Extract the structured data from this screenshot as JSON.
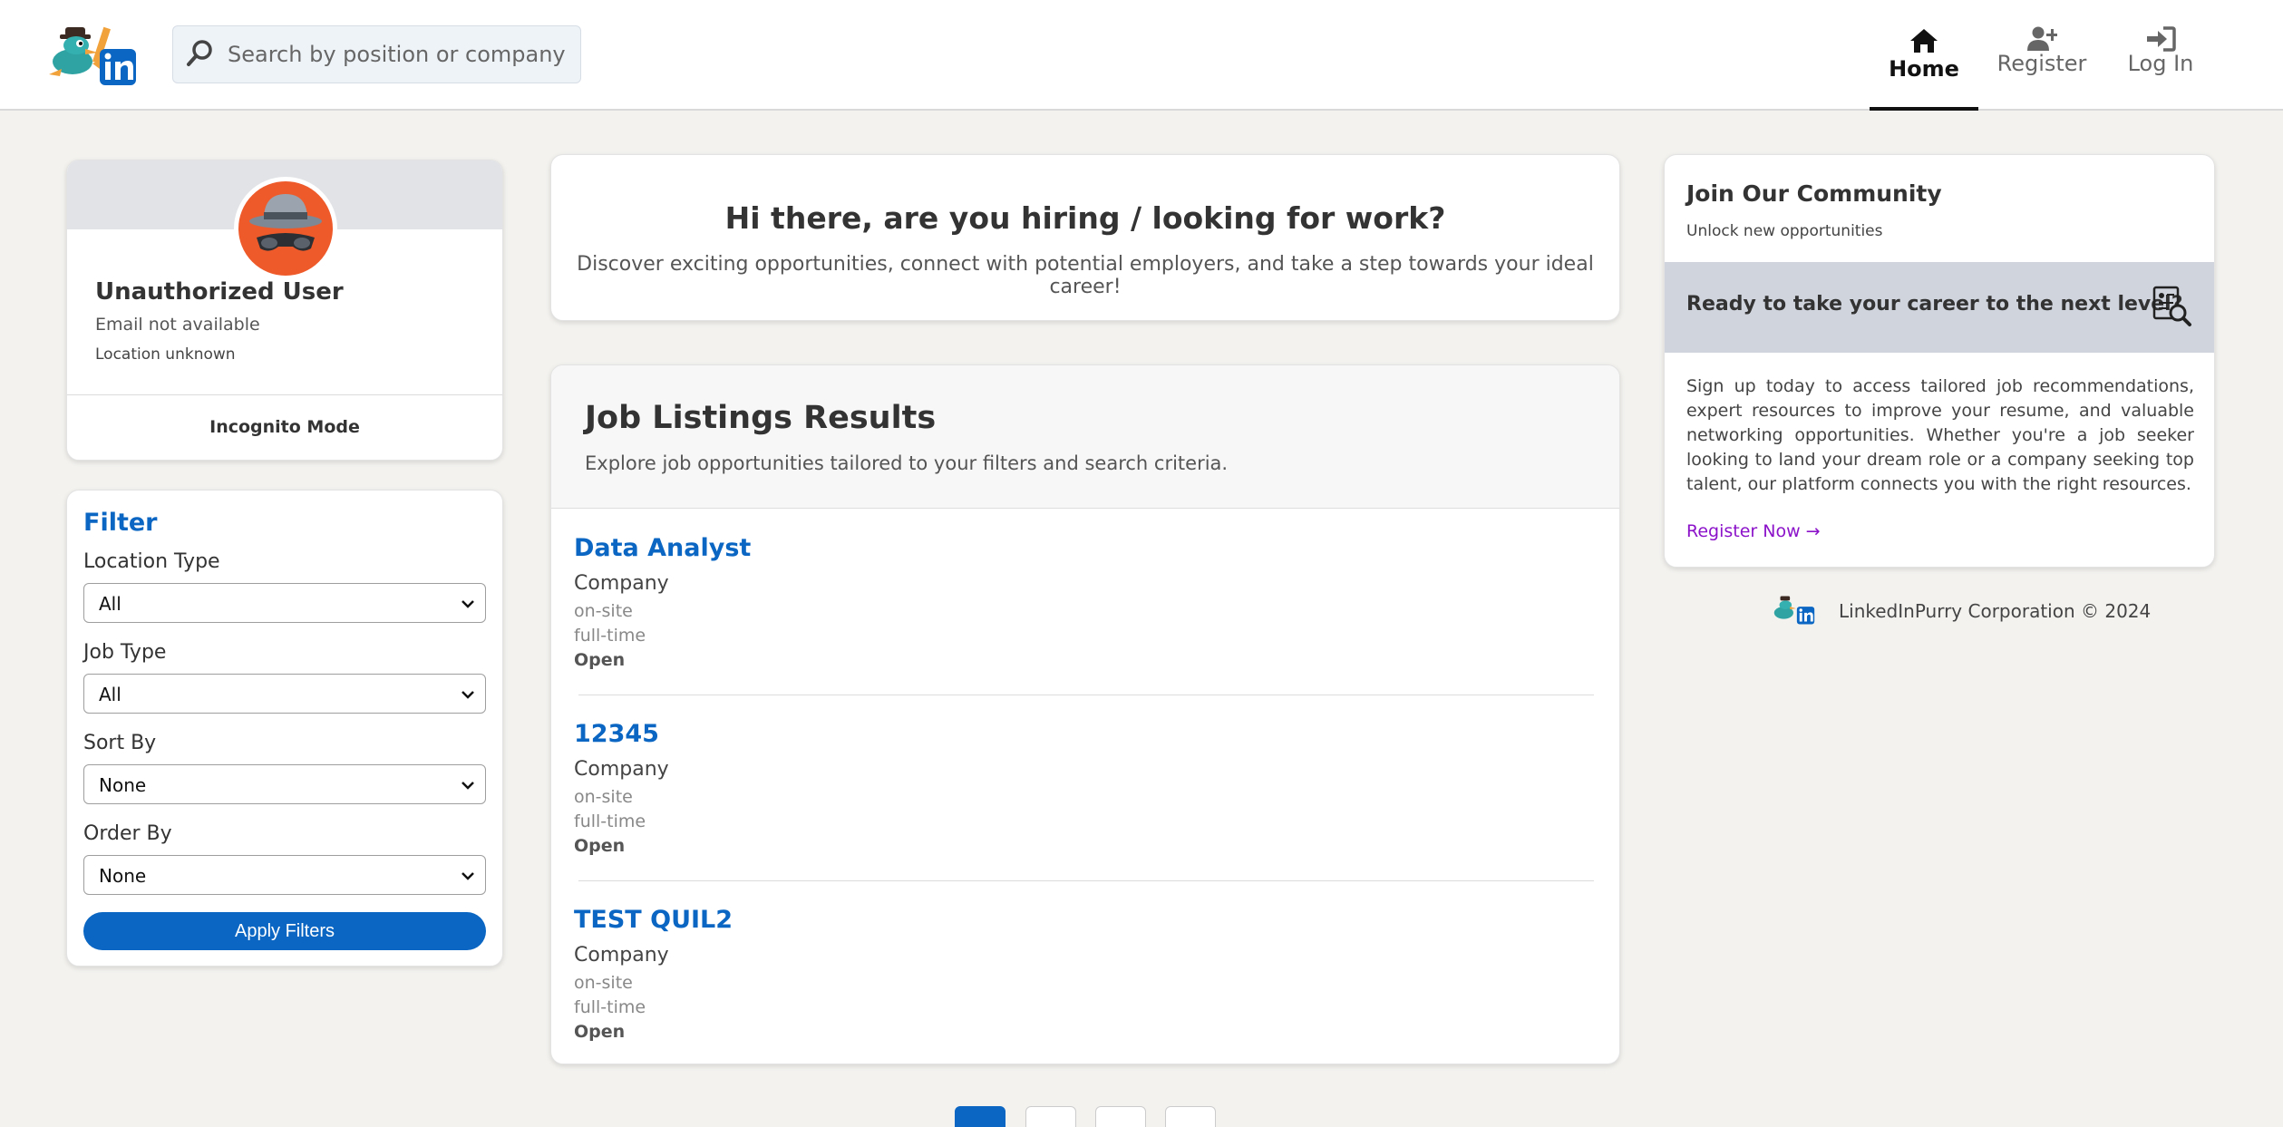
{
  "header": {
    "search_placeholder": "Search by position or company",
    "nav": [
      {
        "label": "Home",
        "icon": "home-icon",
        "active": true
      },
      {
        "label": "Register",
        "icon": "user-plus-icon",
        "active": false
      },
      {
        "label": "Log In",
        "icon": "sign-in-icon",
        "active": false
      }
    ]
  },
  "profile": {
    "name": "Unauthorized User",
    "email": "Email not available",
    "location": "Location unknown",
    "mode": "Incognito Mode"
  },
  "filter": {
    "title": "Filter",
    "fields": [
      {
        "label": "Location Type",
        "value": "All"
      },
      {
        "label": "Job Type",
        "value": "All"
      },
      {
        "label": "Sort By",
        "value": "None"
      },
      {
        "label": "Order By",
        "value": "None"
      }
    ],
    "apply_label": "Apply Filters"
  },
  "hero": {
    "title": "Hi there, are you hiring / looking for work?",
    "subtitle": "Discover exciting opportunities, connect with potential employers, and take a step towards your ideal career!"
  },
  "listings": {
    "title": "Job Listings Results",
    "subtitle": "Explore job opportunities tailored to your filters and search criteria.",
    "jobs": [
      {
        "title": "Data Analyst",
        "company": "Company",
        "location_type": "on-site",
        "job_type": "full-time",
        "status": "Open"
      },
      {
        "title": "12345",
        "company": "Company",
        "location_type": "on-site",
        "job_type": "full-time",
        "status": "Open"
      },
      {
        "title": "TEST QUIL2",
        "company": "Company",
        "location_type": "on-site",
        "job_type": "full-time",
        "status": "Open"
      }
    ]
  },
  "community": {
    "title": "Join Our Community",
    "subtitle": "Unlock new opportunities",
    "banner": "Ready to take your career to the next level?",
    "body": "Sign up today to access tailored job recommendations, expert resources to improve your resume, and valuable networking opportunities. Whether you're a job seeker looking to land your dream role or a company seeking top talent, our platform connects you with the right resources.",
    "link": "Register Now →"
  },
  "footer": {
    "text": "LinkedInPurry Corporation © 2024"
  },
  "colors": {
    "brand": "#0a66c2",
    "link_purple": "#8b12c9",
    "background": "#f3f2ef"
  }
}
